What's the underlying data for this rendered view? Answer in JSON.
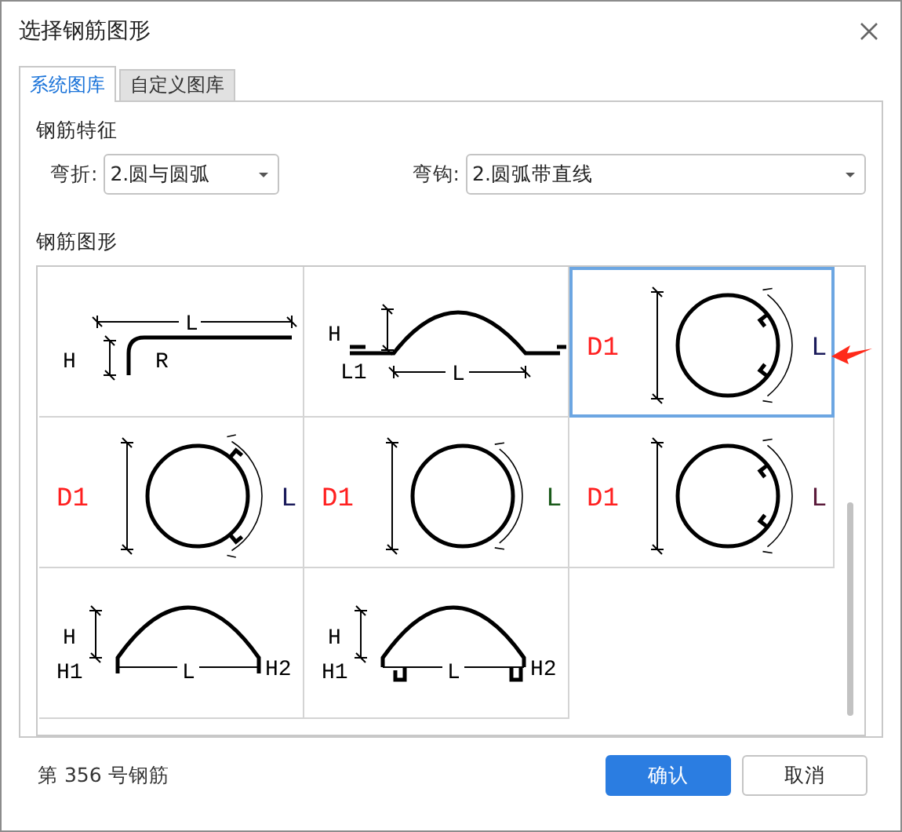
{
  "window": {
    "title": "选择钢筋图形"
  },
  "tabs": [
    {
      "label": "系统图库",
      "selected": true
    },
    {
      "label": "自定义图库",
      "selected": false
    }
  ],
  "features": {
    "title": "钢筋特征",
    "fields": [
      {
        "label": "弯折:",
        "value": "2.圆与圆弧"
      },
      {
        "label": "弯钩:",
        "value": "2.圆弧带直线"
      }
    ]
  },
  "gallery": {
    "title": "钢筋图形",
    "shapes": [
      {
        "kind": "bend",
        "selected": false,
        "labels": [
          {
            "text": "H",
            "color": "#000000"
          },
          {
            "text": "L",
            "color": "#000000"
          },
          {
            "text": "R",
            "color": "#000000"
          }
        ]
      },
      {
        "kind": "arch-flat-ends",
        "selected": false,
        "labels": [
          {
            "text": "H",
            "color": "#000000"
          },
          {
            "text": "L1",
            "color": "#000000"
          },
          {
            "text": "L",
            "color": "#000000"
          }
        ]
      },
      {
        "kind": "ring-inner-hooks",
        "selected": true,
        "labels": [
          {
            "text": "D1",
            "color": "#ff2020"
          },
          {
            "text": "L",
            "color": "#1a1a5a"
          }
        ]
      },
      {
        "kind": "ring-outer-hooks",
        "selected": false,
        "labels": [
          {
            "text": "D1",
            "color": "#ff2020"
          },
          {
            "text": "L",
            "color": "#1a1a5a"
          }
        ]
      },
      {
        "kind": "ring-plain",
        "selected": false,
        "labels": [
          {
            "text": "D1",
            "color": "#ff2020"
          },
          {
            "text": "L",
            "color": "#1a5a1a"
          }
        ]
      },
      {
        "kind": "ring-inner-hooks",
        "selected": false,
        "labels": [
          {
            "text": "D1",
            "color": "#ff2020"
          },
          {
            "text": "L",
            "color": "#5a1a3a"
          }
        ]
      },
      {
        "kind": "arch",
        "selected": false,
        "labels": [
          {
            "text": "H",
            "color": "#000000"
          },
          {
            "text": "H1",
            "color": "#000000"
          },
          {
            "text": "L",
            "color": "#000000"
          },
          {
            "text": "H2",
            "color": "#000000"
          }
        ]
      },
      {
        "kind": "arch-u-hooks",
        "selected": false,
        "labels": [
          {
            "text": "H",
            "color": "#000000"
          },
          {
            "text": "H1",
            "color": "#000000"
          },
          {
            "text": "L",
            "color": "#000000"
          },
          {
            "text": "H2",
            "color": "#000000"
          }
        ]
      }
    ]
  },
  "status": "第 356 号钢筋",
  "buttons": [
    {
      "label": "确认",
      "kind": "primary"
    },
    {
      "label": "取消",
      "kind": "default"
    }
  ]
}
